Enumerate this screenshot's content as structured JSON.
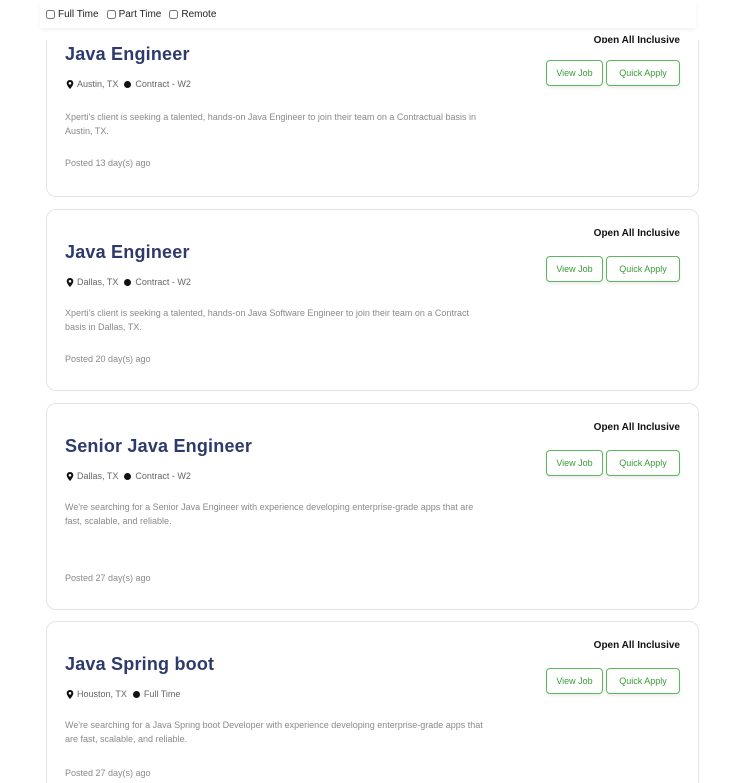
{
  "filters": {
    "full_time": "Full Time",
    "part_time": "Part Time",
    "remote": "Remote"
  },
  "buttons": {
    "view": "View Job",
    "apply": "Quick Apply"
  },
  "jobs": [
    {
      "badge": "Open All Inclusive",
      "title": "Java Engineer",
      "location": "Austin, TX",
      "type": "Contract - W2",
      "description": "Xperti's client is seeking a talented, hands-on Java Engineer to join their team on a Contractual basis in Austin, TX.",
      "posted": "Posted 13 day(s) ago"
    },
    {
      "badge": "Open All Inclusive",
      "title": "Java Engineer",
      "location": "Dallas, TX",
      "type": "Contract - W2",
      "description": "Xperti's client is seeking a talented, hands-on Java Software Engineer to join their team on a Contract basis in Dallas, TX.",
      "posted": "Posted 20 day(s) ago"
    },
    {
      "badge": "Open All Inclusive",
      "title": "Senior Java Engineer",
      "location": "Dallas, TX",
      "type": "Contract - W2",
      "description": "We're searching for a Senior Java Engineer with experience developing enterprise-grade apps that are fast, scalable, and reliable.",
      "posted": "Posted 27 day(s) ago"
    },
    {
      "badge": "Open All Inclusive",
      "title": "Java Spring boot",
      "location": "Houston, TX",
      "type": "Full Time",
      "description": "We're searching for a Java Spring boot Developer with experience developing enterprise-grade apps that are fast, scalable, and reliable.",
      "posted": "Posted 27 day(s) ago"
    }
  ]
}
